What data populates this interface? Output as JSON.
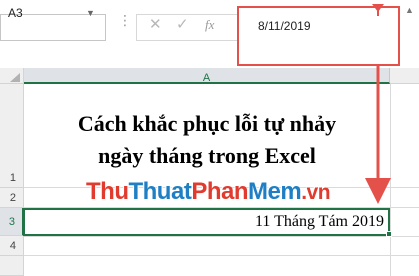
{
  "name_box": {
    "value": "A3"
  },
  "formula_bar": {
    "cancel_glyph": "✕",
    "enter_glyph": "✓",
    "fx_label": "fx",
    "value": "8/11/2019"
  },
  "sheet": {
    "column_header": "A",
    "row_headers": [
      "1",
      "2",
      "3",
      "4"
    ],
    "title_line1": "Cách khắc phục lỗi tự nhảy",
    "title_line2": "ngày tháng trong Excel",
    "a3_value": "11 Tháng Tám 2019"
  },
  "watermark": {
    "part1": "Thu",
    "part2": "Thuat",
    "part3": "Phan",
    "part4": "Mem",
    "part5": ".vn"
  },
  "colors": {
    "excel_green": "#217346",
    "highlight_red": "#e4514b",
    "watermark_red": "#e03b2e",
    "watermark_blue": "#1f7fc4"
  }
}
